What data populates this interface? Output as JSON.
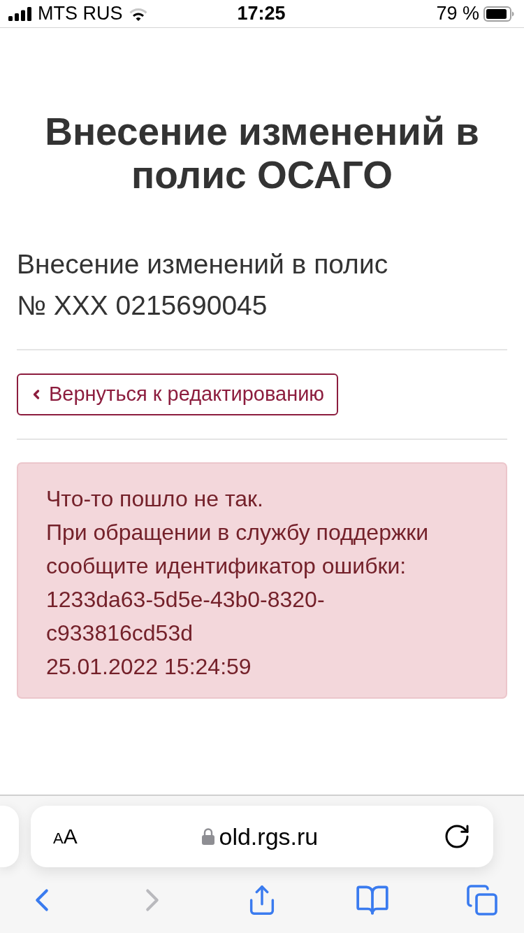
{
  "status_bar": {
    "carrier": "MTS RUS",
    "time": "17:25",
    "battery": "79 %"
  },
  "page": {
    "title": "Внесение изменений в полис ОСАГО",
    "subtitle_lines": [
      "Внесение изменений в полис",
      "№ XXX 0215690045"
    ],
    "back_button": "Вернуться к редактированию",
    "alert_lines": [
      "Что-то пошло не так.",
      "При обращении в службу поддержки",
      "сообщите идентификатор ошибки:",
      "1233da63-5d5e-43b0-8320-",
      "c933816cd53d",
      "25.01.2022 15:24:59"
    ]
  },
  "browser": {
    "text_size": "AA",
    "url": "old.rgs.ru",
    "toolbar": [
      {
        "kind": "back",
        "disabled": false
      },
      {
        "kind": "forward",
        "disabled": true
      },
      {
        "kind": "share",
        "disabled": false
      },
      {
        "kind": "bookmarks",
        "disabled": false
      },
      {
        "kind": "tabs",
        "disabled": false
      }
    ]
  }
}
